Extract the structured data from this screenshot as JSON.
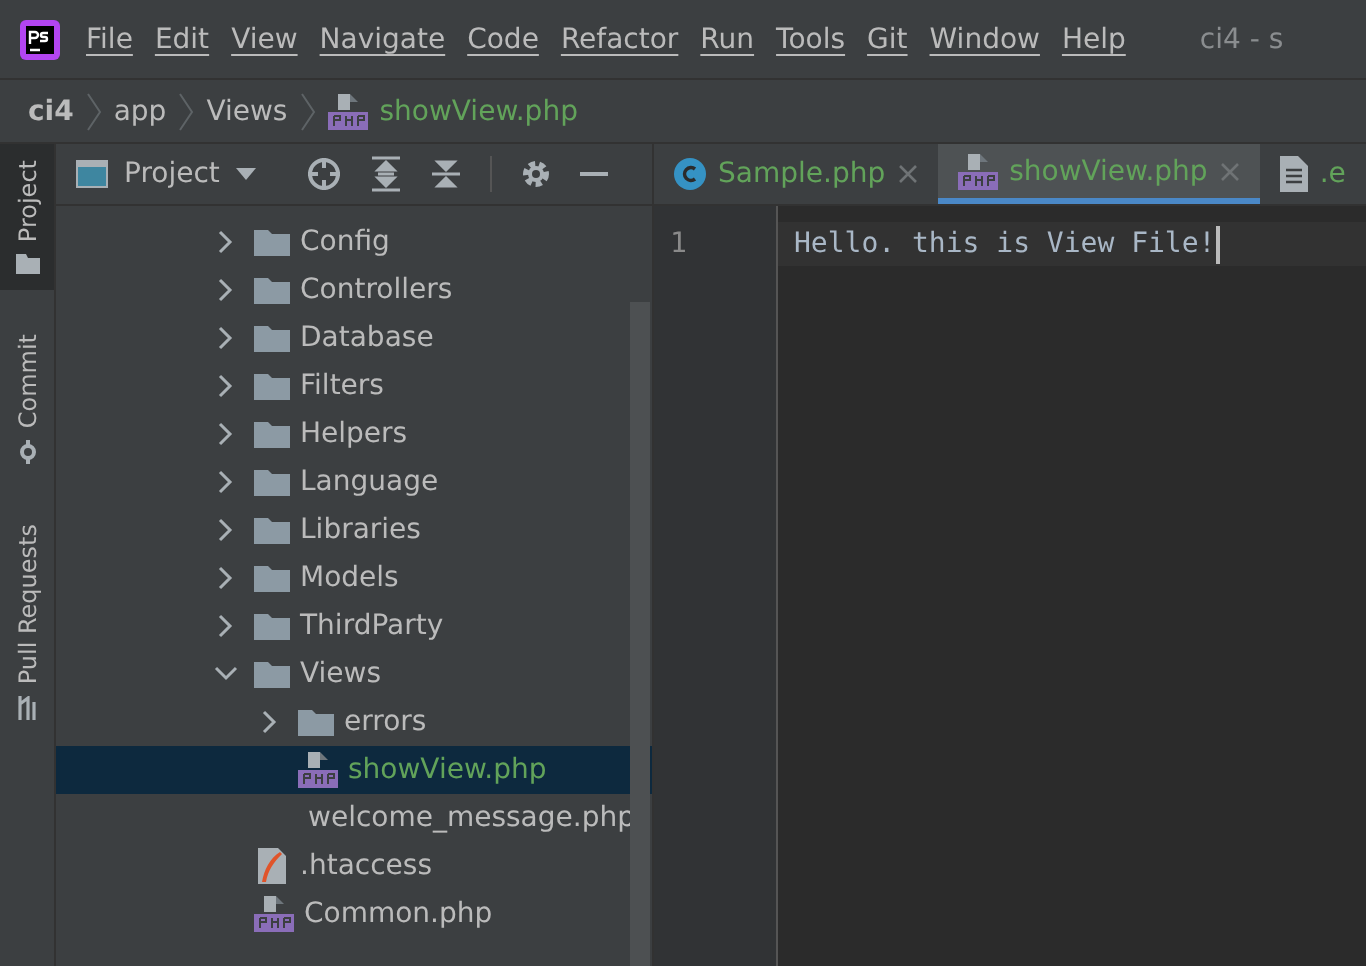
{
  "window": {
    "title": "ci4 - s"
  },
  "menu": [
    "File",
    "Edit",
    "View",
    "Navigate",
    "Code",
    "Refactor",
    "Run",
    "Tools",
    "Git",
    "Window",
    "Help"
  ],
  "breadcrumb": [
    {
      "label": "ci4",
      "kind": "project"
    },
    {
      "label": "app",
      "kind": "folder"
    },
    {
      "label": "Views",
      "kind": "folder"
    },
    {
      "label": "showView.php",
      "kind": "php"
    }
  ],
  "tool_strip": [
    {
      "label": "Project",
      "selected": true,
      "kind": "project"
    },
    {
      "label": "Commit",
      "selected": false,
      "kind": "commit"
    },
    {
      "label": "Pull Requests",
      "selected": false,
      "kind": "pull"
    }
  ],
  "project_panel": {
    "title": "Project"
  },
  "tree": [
    {
      "label": "Config",
      "kind": "folder",
      "expanded": false,
      "selected": false
    },
    {
      "label": "Controllers",
      "kind": "folder",
      "expanded": false,
      "selected": false
    },
    {
      "label": "Database",
      "kind": "folder",
      "expanded": false,
      "selected": false
    },
    {
      "label": "Filters",
      "kind": "folder",
      "expanded": false,
      "selected": false
    },
    {
      "label": "Helpers",
      "kind": "folder",
      "expanded": false,
      "selected": false
    },
    {
      "label": "Language",
      "kind": "folder",
      "expanded": false,
      "selected": false
    },
    {
      "label": "Libraries",
      "kind": "folder",
      "expanded": false,
      "selected": false
    },
    {
      "label": "Models",
      "kind": "folder",
      "expanded": false,
      "selected": false
    },
    {
      "label": "ThirdParty",
      "kind": "folder",
      "expanded": false,
      "selected": false
    },
    {
      "label": "Views",
      "kind": "folder",
      "expanded": true,
      "selected": false,
      "children": [
        {
          "label": "errors",
          "kind": "folder",
          "expanded": false,
          "selected": false
        },
        {
          "label": "showView.php",
          "kind": "php",
          "selected": true
        },
        {
          "label": "welcome_message.php",
          "kind": "php",
          "selected": false
        }
      ]
    },
    {
      "label": ".htaccess",
      "kind": "htaccess",
      "selected": false
    },
    {
      "label": "Common.php",
      "kind": "php",
      "selected": false
    }
  ],
  "tabs": [
    {
      "label": "Sample.php",
      "kind": "class",
      "selected": false
    },
    {
      "label": "showView.php",
      "kind": "php",
      "selected": true
    },
    {
      "label": ".e",
      "kind": "text",
      "selected": false
    }
  ],
  "editor": {
    "lines": [
      {
        "number": "1",
        "text": "Hello. this is View File!"
      }
    ]
  }
}
